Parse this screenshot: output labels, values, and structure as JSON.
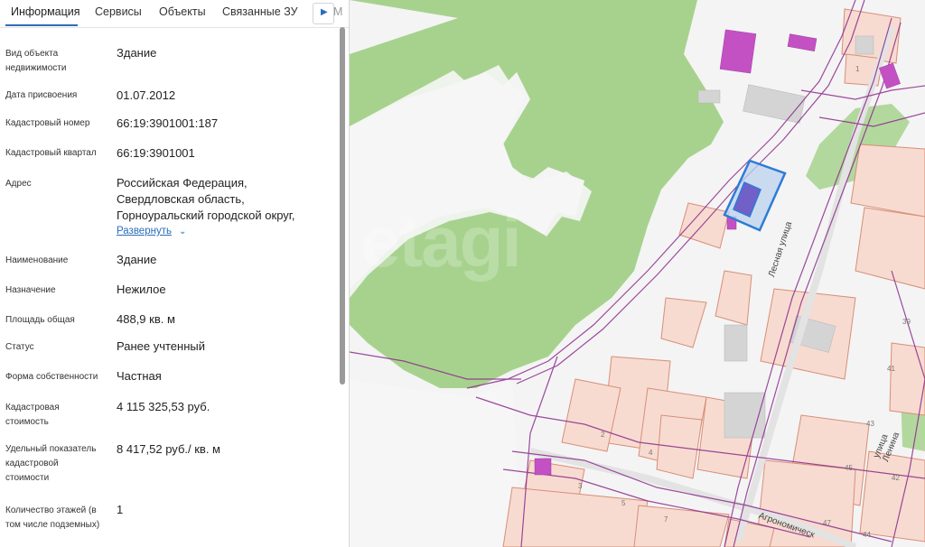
{
  "tabs": [
    {
      "label": "Информация"
    },
    {
      "label": "Сервисы"
    },
    {
      "label": "Объекты"
    },
    {
      "label": "Связанные ЗУ"
    },
    {
      "label": "М"
    }
  ],
  "info": {
    "object_type": {
      "label": "Вид объекта недвижимости",
      "value": "Здание"
    },
    "assign_date": {
      "label": "Дата присвоения",
      "value": "01.07.2012"
    },
    "cadastral_number": {
      "label": "Кадастровый номер",
      "value": "66:19:3901001:187"
    },
    "cadastral_quarter": {
      "label": "Кадастровый квартал",
      "value": "66:19:3901001"
    },
    "address": {
      "label": "Адрес",
      "line1": "Российская Федерация,",
      "line2": "Свердловская область,",
      "line3": "Горноуральский городской округ,",
      "expand_label": "Развернуть"
    },
    "name": {
      "label": "Наименование",
      "value": "Здание"
    },
    "purpose": {
      "label": "Назначение",
      "value": "Нежилое"
    },
    "area": {
      "label": "Площадь общая",
      "value": "488,9 кв. м"
    },
    "status": {
      "label": "Статус",
      "value": "Ранее учтенный"
    },
    "ownership": {
      "label": "Форма собственности",
      "value": "Частная"
    },
    "cadastral_value": {
      "label": "Кадастровая стоимость",
      "value": "4 115 325,53 руб."
    },
    "specific_value": {
      "label": "Удельный показатель кадастровой стоимости",
      "value": "8 417,52 руб./ кв. м"
    },
    "floors": {
      "label": "Количество этажей (в том числе подземных)",
      "value": "1"
    }
  },
  "map": {
    "watermark": "etagi",
    "street_lesnaya": "Лесная улица",
    "street_lenina": "улица Ленина",
    "street_agronom": "Агрономическ",
    "house_numbers": [
      "39",
      "41",
      "43",
      "45",
      "47",
      "44",
      "42",
      "2",
      "4",
      "3",
      "5",
      "7",
      "1"
    ]
  },
  "colors": {
    "accent": "#2a6db8",
    "forest": "#a6d28d",
    "parcel": "#f7d9cf",
    "parcel_border": "#d98c76",
    "boundary": "#8a2a8a",
    "building": "#c44fc4",
    "selected": "#2e7bd6"
  }
}
